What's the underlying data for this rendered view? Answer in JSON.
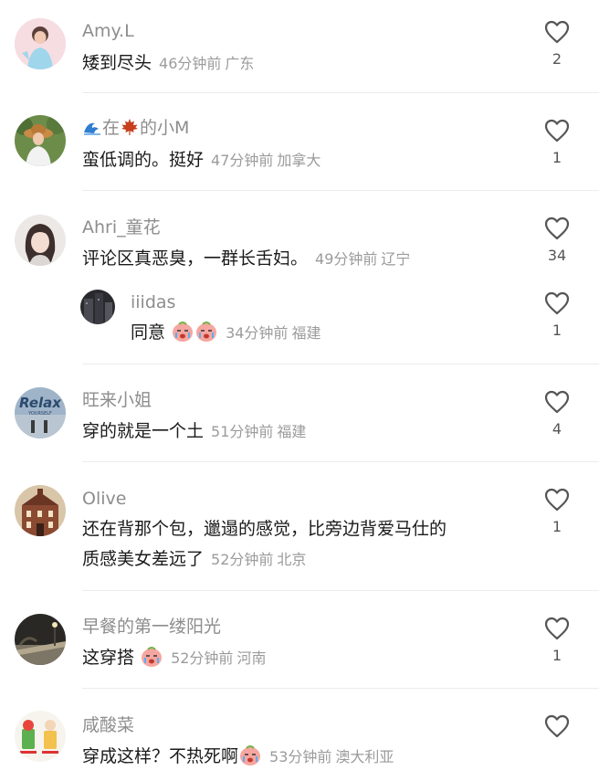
{
  "comments": [
    {
      "username": "Amy.L",
      "text": "矮到尽头",
      "time": "46分钟前",
      "location": "广东",
      "likes": "2",
      "avatar": "avatar-girl-pink"
    },
    {
      "username_prefix": "在",
      "username_suffix": "的小M",
      "text": "蛮低调的。挺好",
      "time": "47分钟前",
      "location": "加拿大",
      "likes": "1",
      "avatar": "avatar-sunhat"
    },
    {
      "username": "Ahri_童花",
      "text": "评论区真恶臭，一群长舌妇。",
      "time": "49分钟前",
      "location": "辽宁",
      "likes": "34",
      "avatar": "avatar-girl-bob"
    },
    {
      "username": "iiidas",
      "text": "同意",
      "time": "34分钟前",
      "location": "福建",
      "likes": "1",
      "avatar": "avatar-dark-building"
    },
    {
      "username": "旺来小姐",
      "text": "穿的就是一个土",
      "time": "51分钟前",
      "location": "福建",
      "likes": "4",
      "avatar": "avatar-relax"
    },
    {
      "username": "Olive",
      "text_line1": "还在背那个包，邋遢的感觉，比旁边背爱马仕的",
      "text_line2": "质感美女差远了",
      "time": "52分钟前",
      "location": "北京",
      "likes": "1",
      "avatar": "avatar-castle"
    },
    {
      "username": "早餐的第一缕阳光",
      "text": "这穿搭",
      "time": "52分钟前",
      "location": "河南",
      "likes": "1",
      "avatar": "avatar-night-street"
    },
    {
      "username": "咸酸菜",
      "text": "穿成这样？不热死啊",
      "time": "53分钟前",
      "location": "澳大利亚",
      "likes": "",
      "avatar": "avatar-cartoon"
    }
  ],
  "avatar_badge_text": "Relax",
  "avatar_badge_subtext": "YOURSELF",
  "colors": {
    "username": "#8d8d8d",
    "meta": "#9b9b9b",
    "text": "#1a1a1a",
    "heart": "#555555",
    "divider": "#ececec",
    "emoji_face": "#f6a6a0"
  }
}
